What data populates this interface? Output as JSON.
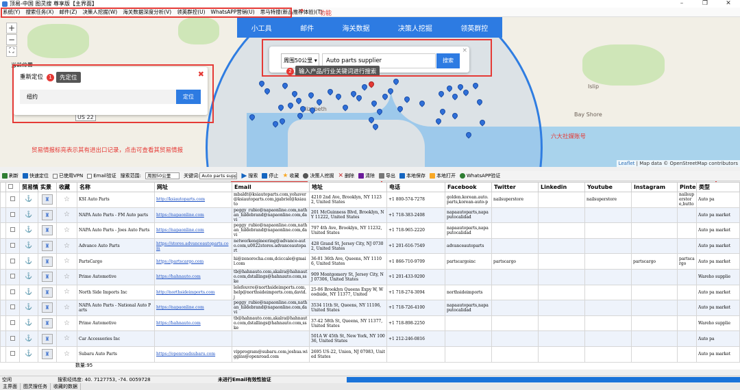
{
  "window": {
    "title": "顶易-中国 图灵搜 尊享版【主界面】"
  },
  "menu": [
    "系统(Y)",
    "搜索任务(X)",
    "邮件(Z)",
    "决策人挖掘(W)",
    "海关数据深度分析(V)",
    "领英群控(U)",
    "WhatsAPP营销(U)",
    "思马特搜(新品推荐体验)(T)"
  ],
  "annotations": {
    "function": "功能",
    "social": "六大社媒账号",
    "trade": "贸易情报标亮表示其有进出口记录，点击可查看其贸易情报",
    "step1": "先定位",
    "step2": "输入产品/行业关键词进行搜索",
    "n1": "1",
    "n2": "2"
  },
  "map_nav": [
    "小工具",
    "邮件",
    "海关数据",
    "决策人挖掘",
    "领英群控"
  ],
  "search_popup": {
    "radius": "周围50公里 ▾",
    "keyword": "Auto parts supplier",
    "button": "搜索",
    "close": "×"
  },
  "locate_popup": {
    "title": "重新定位",
    "input": "纽约",
    "button": "定位",
    "close": "✖",
    "current": "当前位置"
  },
  "map": {
    "zoom_in": "+",
    "zoom_out": "−",
    "fullscreen": "⛶",
    "labels": [
      "Elizabeth",
      "US 22",
      "Islip",
      "Bay Shore"
    ],
    "attribution_link": "Leaflet",
    "attribution_text": "| Map data © OpenStreetMap contributors"
  },
  "toolbar": [
    {
      "label": "刷新",
      "icon": "refresh-icon",
      "color": "#2e7d32"
    },
    {
      "label": "快速定位",
      "icon": "locate-icon",
      "color": "#1565c0"
    },
    {
      "label": "已使用VPN",
      "icon": "checkbox-icon",
      "color": ""
    },
    {
      "label": "Email验证",
      "icon": "checkbox-icon",
      "color": ""
    },
    {
      "label": "搜索范围:",
      "icon": "",
      "color": ""
    }
  ],
  "toolbar_range": "周围50公里",
  "toolbar_kw_label": "关键词:",
  "toolbar_kw": "Auto parts suppl",
  "toolbar_actions": [
    {
      "label": "搜索",
      "icon": "play-icon",
      "color": "#1565c0"
    },
    {
      "label": "停止",
      "icon": "stop-icon",
      "color": "#1565c0"
    },
    {
      "label": "收藏",
      "icon": "star-icon",
      "color": "#f9a825"
    },
    {
      "label": "决策人挖掘",
      "icon": "user-search-icon",
      "color": "#555"
    },
    {
      "label": "删除",
      "icon": "delete-icon",
      "color": "#c62828"
    },
    {
      "label": "清除",
      "icon": "clear-icon",
      "color": "#6a1b9a"
    },
    {
      "label": "导出",
      "icon": "export-icon",
      "color": "#555"
    },
    {
      "label": "本地保存",
      "icon": "save-icon",
      "color": "#1565c0"
    },
    {
      "label": "本地打开",
      "icon": "folder-icon",
      "color": "#f9a825"
    },
    {
      "label": "WhatsAPP验证",
      "icon": "whatsapp-icon",
      "color": "#2e7d32"
    }
  ],
  "table": {
    "headers": [
      "",
      "贸易情报",
      "实景",
      "收藏",
      "名称",
      "网址",
      "Email",
      "地址",
      "电话",
      "Facebook",
      "Twitter",
      "Linkedin",
      "Youtube",
      "Instagram",
      "Pinterest",
      "类型"
    ],
    "rows": [
      [
        "KSI Auto Parts",
        "http://ksiautoparts.com",
        "mbaldt@ksiautoparts.com,yohaver@ksiautoparts.com,jgabriel@ksiauto",
        "4210 2nd Ave, Brooklyn, NY 11232, United States",
        "+1 800-574-7278",
        "golden.korean.auto.parts,korean-auto-p",
        "nailsuperstore",
        "",
        "nailsuperstore",
        "",
        "nailsuperstore,butto",
        "Auto pa"
      ],
      [
        "NAPA Auto Parts - FM Auto parts",
        "https://napaonline.com",
        "peggy_rubio@napaonline.com,nathan_hildebrand@napaonline.com,davi",
        "201 McGuinness Blvd, Brooklyn, NY 11222, United States",
        "+1 718-383-2408",
        "napaautoparts,napaputocalidad",
        "",
        "",
        "",
        "",
        "",
        "Auto pa market"
      ],
      [
        "NAPA Auto Parts - Joes Auto Parts",
        "https://napaonline.com",
        "peggy_rubio@napaonline.com,nathan_hildebrand@napaonline.com,davi",
        "797 4th Ave, Brooklyn, NY 11232, United States",
        "+1 718-965-2220",
        "napaautoparts,napaputocalidad",
        "",
        "",
        "",
        "",
        "",
        "Auto pa market"
      ],
      [
        "Advance Auto Parts",
        "https://stores.advanceautoparts.com",
        "networkengineering@advance-auto.com,u0022stores.advanceautopart",
        "428 Grand St, Jersey City, NJ 07302, United States",
        "+1 201-616-7549",
        "advanceautoparts",
        "",
        "",
        "",
        "",
        "",
        "Auto pa market"
      ],
      [
        "PartsCargo",
        "https://partscargo.com",
        "hi@zenorocha.com,dciccale@gmail.com",
        "36-01 36th Ave, Queens, NY 11106, United States",
        "+1 866-710-9709",
        "partscargoinc",
        "partscargo",
        "",
        "",
        "partscargo",
        "partscargo",
        "Auto pa market"
      ],
      [
        "Prime Automotive",
        "https://hahnauto.com",
        "tb@hahnauto.com,akalra@hahnauto.com,dstallings@hahnauto.com,sske",
        "909 Montgomery St, Jersey City, NJ 07306, United States",
        "+1 201-433-9200",
        "",
        "",
        "",
        "",
        "",
        "",
        "Wareho supplie"
      ],
      [
        "North Side Imports Inc",
        "http://northsideimports.com",
        "lolefeuvre@northsideimports.com,help@northsideimports.com,david.j",
        "25-06 Brooklyn Queens Expy W, Woodside, NY 11377, United",
        "+1 718-274-3094",
        "northsideimports",
        "",
        "",
        "",
        "",
        "",
        "Auto pa market"
      ],
      [
        "NAPA Auto Parts - National Auto Parts",
        "https://napaonline.com",
        "peggy_rubio@napaonline.com,nathan_hildebrand@napaonline.com,davi",
        "3534 11th St, Queens, NY 11106, United States",
        "+1 718-726-4100",
        "napaautoparts,napaputocalidad",
        "",
        "",
        "",
        "",
        "",
        "Auto pa market"
      ],
      [
        "Prime Automotive",
        "https://hahnauto.com",
        "tb@hahnauto.com,akalra@hahnauto.com,dstallings@hahnauto.com,sske",
        "37-42 58th St, Queens, NY 11377, United States",
        "+1 718-898-2250",
        "",
        "",
        "",
        "",
        "",
        "",
        "Wareho supplie"
      ],
      [
        "Car Accessories Inc",
        "",
        "",
        "501A W 45th St, New York, NY 10036, United States",
        "+1 212-246-0816",
        "",
        "",
        "",
        "",
        "",
        "",
        "Auto pa"
      ],
      [
        "Subaru Auto Parts",
        "https://openroadsubaru.com",
        "vipprogram@subaru.com,joshua.wiggins@openroad.com",
        "2695 US-22, Union, NJ 07083, United States",
        "",
        "",
        "",
        "",
        "",
        "",
        "",
        "Auto pa market"
      ]
    ]
  },
  "count": "数量:95",
  "status": {
    "left": "空闲",
    "coords": "搜索经纬度: 40. 7127753, -74. 0059728",
    "email": "未进行Email有效性验证"
  },
  "bottom_tabs": [
    "主界面",
    "图灵搜任务",
    "收藏的数据"
  ]
}
